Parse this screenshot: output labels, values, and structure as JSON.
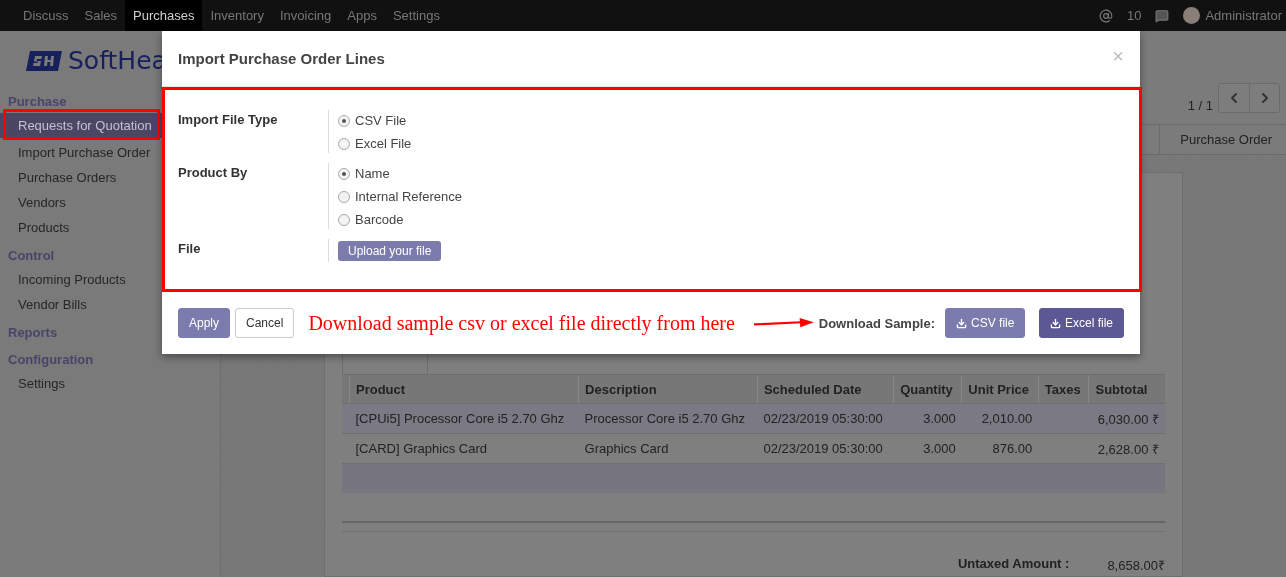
{
  "navbar": {
    "menus": [
      {
        "label": "Discuss",
        "selected": false
      },
      {
        "label": "Sales",
        "selected": false
      },
      {
        "label": "Purchases",
        "selected": true
      },
      {
        "label": "Inventory",
        "selected": false
      },
      {
        "label": "Invoicing",
        "selected": false
      },
      {
        "label": "Apps",
        "selected": false
      },
      {
        "label": "Settings",
        "selected": false
      }
    ],
    "mention_count": "10",
    "user": "Administrator"
  },
  "brand": {
    "text": "SoftHea"
  },
  "sidebar": {
    "sections": [
      {
        "title": "Purchase",
        "items": [
          {
            "label": "Requests for Quotation",
            "selected": true
          },
          {
            "label": "Import Purchase Order",
            "selected": false
          },
          {
            "label": "Purchase Orders",
            "selected": false
          },
          {
            "label": "Vendors",
            "selected": false
          },
          {
            "label": "Products",
            "selected": false
          }
        ]
      },
      {
        "title": "Control",
        "items": [
          {
            "label": "Incoming Products",
            "selected": false
          },
          {
            "label": "Vendor Bills",
            "selected": false
          }
        ]
      },
      {
        "title": "Reports"
      },
      {
        "title": "Configuration",
        "items": [
          {
            "label": "Settings",
            "selected": false
          }
        ]
      }
    ]
  },
  "pager": {
    "text": "1 / 1"
  },
  "status_step": "Purchase Order",
  "table": {
    "columns": [
      "Product",
      "Description",
      "Scheduled Date",
      "Quantity",
      "Unit Price",
      "Taxes",
      "Subtotal"
    ],
    "rows": [
      [
        "[CPUi5] Processor Core i5 2.70 Ghz",
        "Processor Core i5 2.70 Ghz",
        "02/23/2019 05:30:00",
        "3.000",
        "2,010.00",
        "",
        "6,030.00 ₹"
      ],
      [
        "[CARD] Graphics Card",
        "Graphics Card",
        "02/23/2019 05:30:00",
        "3.000",
        "876.00",
        "",
        "2,628.00 ₹"
      ]
    ]
  },
  "totals": [
    {
      "label": "Untaxed Amount :",
      "value": "8,658.00₹"
    }
  ],
  "dialog": {
    "title": "Import Purchase Order Lines",
    "close": "×",
    "fields": [
      {
        "label": "Import File Type",
        "kind": "radio",
        "options": [
          {
            "label": "CSV File",
            "selected": true
          },
          {
            "label": "Excel File",
            "selected": false
          }
        ]
      },
      {
        "label": "Product By",
        "kind": "radio",
        "options": [
          {
            "label": "Name",
            "selected": true
          },
          {
            "label": "Internal Reference",
            "selected": false
          },
          {
            "label": "Barcode",
            "selected": false
          }
        ]
      },
      {
        "label": "File",
        "kind": "upload",
        "button": "Upload your file"
      }
    ],
    "apply": "Apply",
    "cancel": "Cancel",
    "sample_label": "Download Sample:",
    "sample_buttons": [
      {
        "label": "CSV file",
        "color": "#7c7bad"
      },
      {
        "label": "Excel file",
        "color": "#5b5894"
      }
    ]
  },
  "annotation": {
    "text": "Download sample csv or excel file directly from here"
  }
}
